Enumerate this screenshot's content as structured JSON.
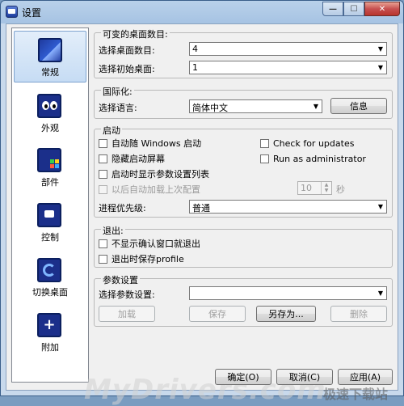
{
  "window": {
    "title": "设置",
    "min_glyph": "—",
    "max_glyph": "☐",
    "close_glyph": "✕"
  },
  "nav": {
    "items": [
      {
        "label": "常规",
        "icon": "desktop-icon"
      },
      {
        "label": "外观",
        "icon": "eyes-icon"
      },
      {
        "label": "部件",
        "icon": "widgets-icon"
      },
      {
        "label": "控制",
        "icon": "control-icon"
      },
      {
        "label": "切换桌面",
        "icon": "switch-desktop-icon"
      },
      {
        "label": "附加",
        "icon": "addon-icon"
      }
    ],
    "active_index": 0,
    "add_glyph": "+"
  },
  "desktops": {
    "title": "可变的桌面数目:",
    "count_label": "选择桌面数目:",
    "count_value": "4",
    "initial_label": "选择初始桌面:",
    "initial_value": "1"
  },
  "i18n": {
    "title": "国际化:",
    "language_label": "选择语言:",
    "language_value": "简体中文",
    "info_button": "信息"
  },
  "startup": {
    "title": "启动",
    "auto_start": "自动随 Windows 启动",
    "hide_splash": "隐藏启动屏幕",
    "show_params": "启动时显示参数设置列表",
    "auto_load_last": "以后自动加载上次配置",
    "check_updates": "Check for updates",
    "run_admin": "Run as administrator",
    "delay_value": "10",
    "delay_unit": "秒",
    "priority_label": "进程优先级:",
    "priority_value": "普通"
  },
  "exit": {
    "title": "退出:",
    "no_confirm": "不显示确认窗口就退出",
    "save_profile": "退出时保存profile"
  },
  "params": {
    "title": "参数设置",
    "select_label": "选择参数设置:",
    "select_value": "",
    "load_button": "加载",
    "save_button": "保存",
    "save_as_button": "另存为...",
    "delete_button": "删除"
  },
  "footer": {
    "ok_button": "确定(O)",
    "cancel_button": "取消(C)",
    "apply_button": "应用(A)"
  },
  "watermark": {
    "text": "MyDrivers.com",
    "site": "极速下载站"
  },
  "glyphs": {
    "dropdown": "▼",
    "spin_up": "▲",
    "spin_down": "▼"
  }
}
